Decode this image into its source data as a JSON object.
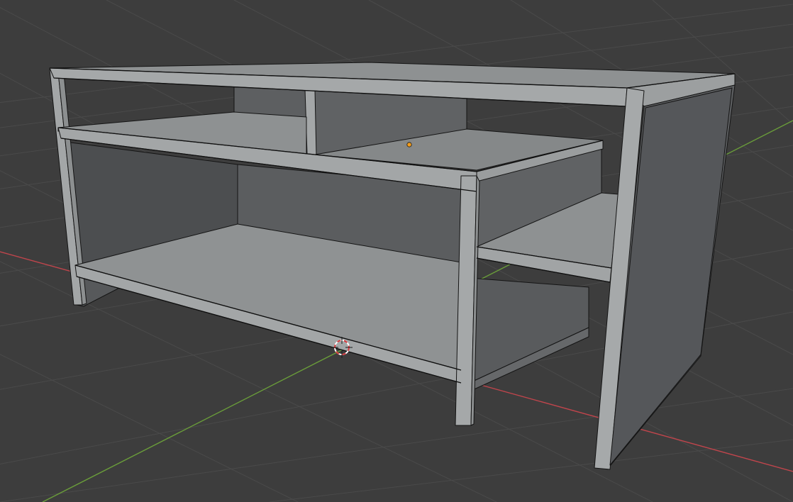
{
  "viewport": {
    "background": "#3d3d3d",
    "grid_color": "#4a4a4a",
    "x_axis_color": "#c0454c",
    "y_axis_color": "#6a9d3a"
  },
  "model": {
    "object": "shelf-unit",
    "face_color_light": "#a2a5a6",
    "face_color_mid": "#8f9293",
    "face_color_dark": "#5f6163",
    "edge_color": "#141414",
    "origin_color": "#f29c1d"
  },
  "cursor": {
    "icon": "3d-cursor-icon",
    "ring_red": "#d8363b",
    "ring_white": "#ffffff"
  }
}
